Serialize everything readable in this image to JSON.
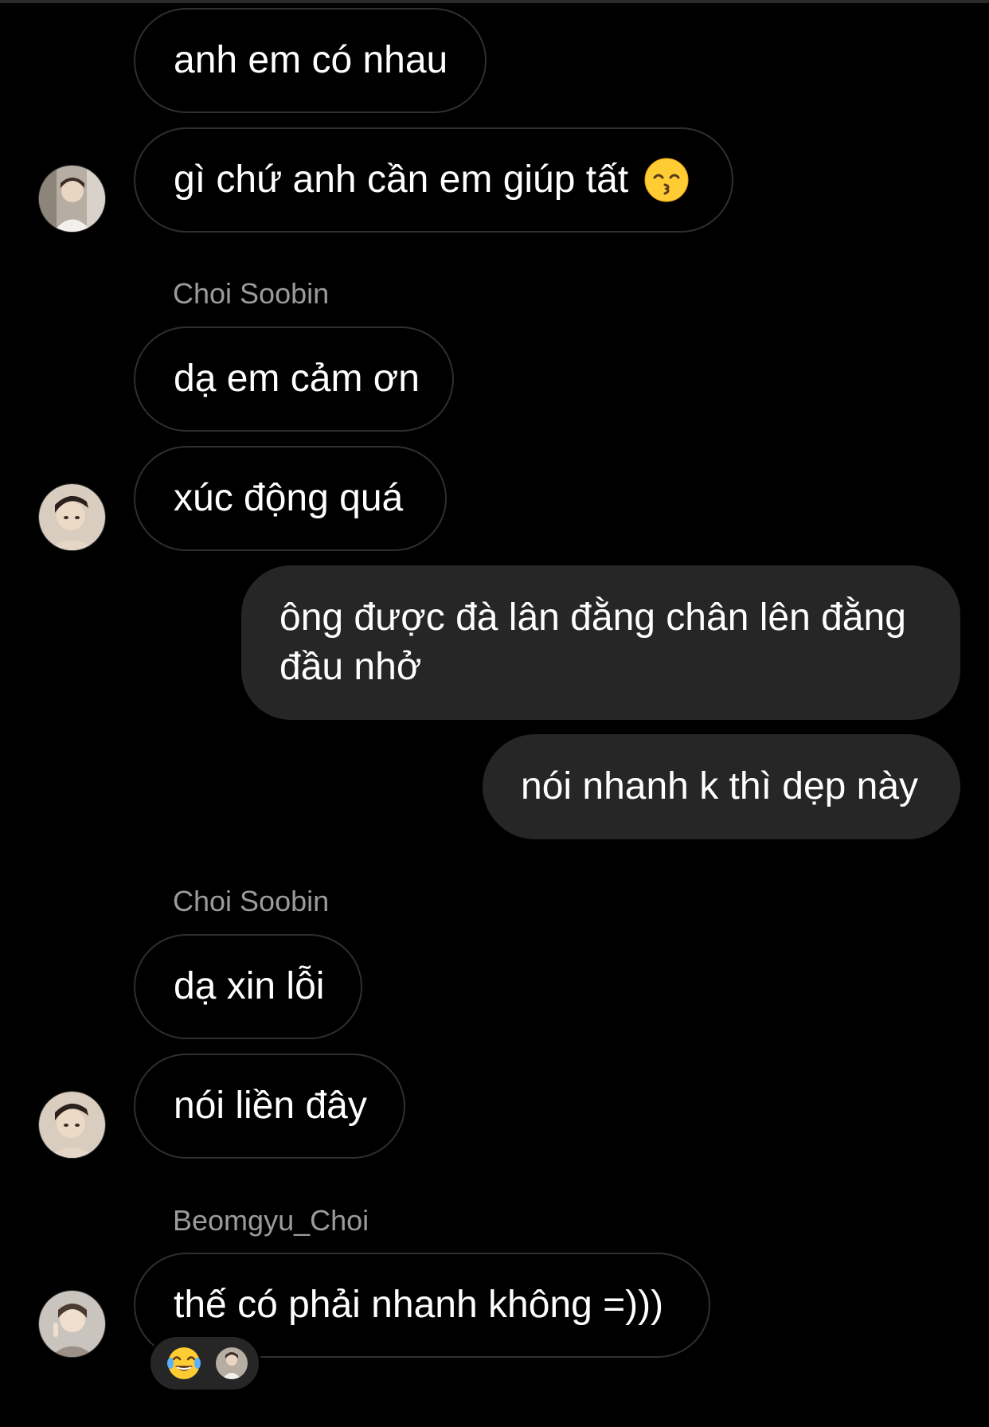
{
  "messages": {
    "m1": "anh em có nhau",
    "m2": "gì chứ anh cần em giúp tất",
    "m3_sender": "Choi Soobin",
    "m3": "dạ em cảm ơn",
    "m4": "xúc động quá",
    "m5": "ông được đà lân đằng chân lên đằng đầu nhở",
    "m6": "nói nhanh k thì dẹp này",
    "m7_sender": "Choi Soobin",
    "m7": "dạ xin lỗi",
    "m8": "nói liền đây",
    "m9_sender": "Beomgyu_Choi",
    "m9": "thế có phải nhanh không =)))"
  },
  "icons": {
    "m2_emoji": "kissing-smiling-eyes-emoji",
    "reaction_emoji": "face-with-tears-of-joy-emoji"
  },
  "colors": {
    "background": "#000000",
    "outgoing_bubble": "#262626",
    "incoming_border": "#2f2f2f",
    "sender_name": "#9b9b9b",
    "text": "#ffffff"
  }
}
